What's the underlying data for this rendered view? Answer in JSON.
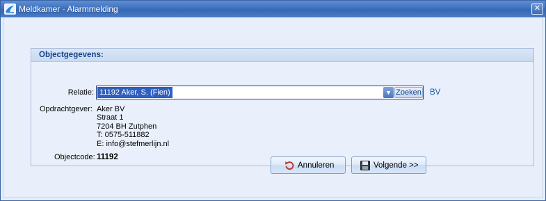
{
  "window": {
    "title": "Meldkamer - Alarmmelding",
    "close_glyph": "✕"
  },
  "group": {
    "title": "Objectgegevens:"
  },
  "relatie": {
    "label": "Relatie:",
    "value": "11192 Aker, S.  (Fien)",
    "search_label": "Zoeken",
    "link": "BV"
  },
  "opdrachtgever": {
    "label": "Opdrachtgever:",
    "lines": [
      "Aker BV",
      "Straat 1",
      "7204 BH  Zutphen",
      "T: 0575-511882",
      "E: info@stefmerlijn.nl"
    ]
  },
  "objectcode": {
    "label": "Objectcode:",
    "value": "11192"
  },
  "buttons": {
    "cancel_label": "Annuleren",
    "next_label": "Volgende >>"
  },
  "colors": {
    "titlebar": "#3f72bd",
    "accent_text": "#15428b",
    "link": "#1e5aa8",
    "selection": "#2f5fbf"
  }
}
